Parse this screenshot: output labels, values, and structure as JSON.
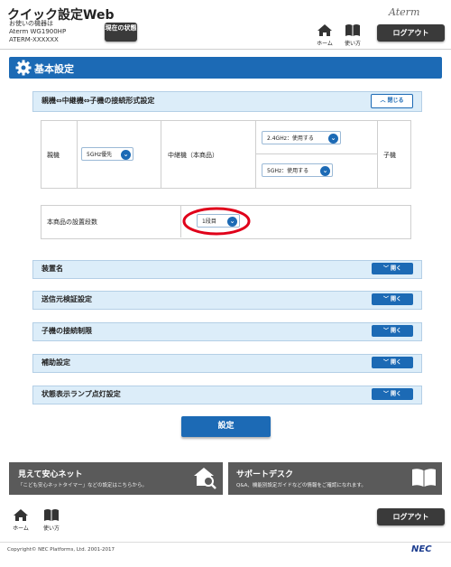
{
  "header": {
    "app_title": "クイック設定Web",
    "device_caption": "お使いの機器は",
    "device_model": "Aterm WG1900HP",
    "device_ssid": "ATERM-XXXXXX",
    "status_button": "現在の状態",
    "brand": "Aterm",
    "home_label": "ホーム",
    "help_label": "使い方",
    "logout": "ログアウト"
  },
  "section": {
    "title": "基本設定"
  },
  "connection_panel": {
    "title": "親機⇔中継機⇔子機の接続形式設定",
    "close_button": "閉じる",
    "parent_label": "親機",
    "parent_select": "5GHz優先",
    "repeater_label": "中継機（本商品）",
    "band24_select": "2.4GHz：使用する",
    "band5_select": "5GHz：使用する",
    "child_label": "子機"
  },
  "install_level": {
    "label": "本商品の設置段数",
    "value": "1段目"
  },
  "panels": [
    {
      "title": "装置名",
      "button": "開く"
    },
    {
      "title": "送信元検証設定",
      "button": "開く"
    },
    {
      "title": "子機の接続制限",
      "button": "開く"
    },
    {
      "title": "補助設定",
      "button": "開く"
    },
    {
      "title": "状態表示ランプ点灯設定",
      "button": "開く"
    }
  ],
  "set_button": "設定",
  "banners": {
    "safety_title": "見えて安心ネット",
    "safety_sub": "「こども安心ネットタイマー」などの設定はこちらから。",
    "support_title": "サポートデスク",
    "support_sub": "Q&A、機能別設定ガイドなどの情報をご確認になれます。"
  },
  "footer": {
    "home_label": "ホーム",
    "help_label": "使い方",
    "logout": "ログアウト",
    "copyright": "Copyright© NEC Platforms, Ltd. 2001-2017",
    "nec_logo": "NEC"
  },
  "colors": {
    "accent": "#1c6ab5",
    "panel_bg": "#dcedf9",
    "dark_button": "#3a3a3a",
    "highlight_circle": "#e0001a"
  }
}
